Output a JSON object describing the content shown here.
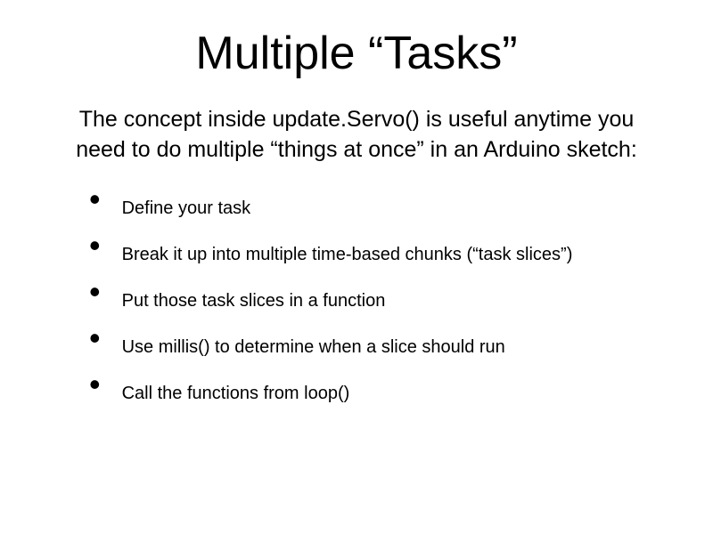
{
  "slide": {
    "title": "Multiple “Tasks”",
    "subtitle": "The concept inside update.Servo() is useful anytime you need to do multiple “things at once” in an Arduino sketch:",
    "bullets": [
      "Define your task",
      "Break it up into multiple time-based chunks (“task slices”)",
      "Put those task slices in a function",
      "Use millis() to determine when a slice should run",
      "Call the functions from loop()"
    ]
  }
}
